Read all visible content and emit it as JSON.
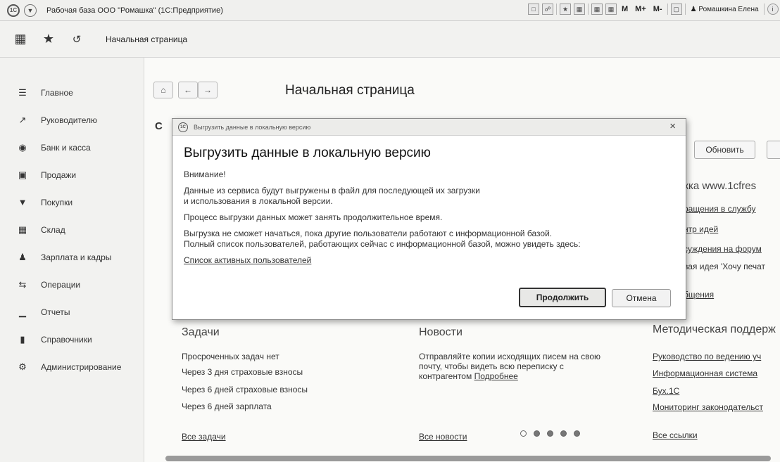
{
  "titlebar": {
    "logo": "1С",
    "title": "Рабочая база ООО \"Ромашка\" (1С:Предприятие)",
    "tools": [
      "M",
      "M+",
      "M-"
    ],
    "user": "Ромашкина Елена"
  },
  "sectionbar": {
    "tab": "Начальная страница"
  },
  "sidebar": {
    "items": [
      {
        "label": "Главное",
        "icon": "menu-icon"
      },
      {
        "label": "Руководителю",
        "icon": "chart-icon"
      },
      {
        "label": "Банк и касса",
        "icon": "coin-icon"
      },
      {
        "label": "Продажи",
        "icon": "bag-icon"
      },
      {
        "label": "Покупки",
        "icon": "cart-icon"
      },
      {
        "label": "Склад",
        "icon": "warehouse-icon"
      },
      {
        "label": "Зарплата и кадры",
        "icon": "person-icon"
      },
      {
        "label": "Операции",
        "icon": "operations-icon"
      },
      {
        "label": "Отчеты",
        "icon": "reports-icon"
      },
      {
        "label": "Справочники",
        "icon": "book-icon"
      },
      {
        "label": "Администрирование",
        "icon": "gear-icon"
      }
    ]
  },
  "main": {
    "title": "Начальная страница",
    "section_letter": "С",
    "refresh_label": "Обновить",
    "support": {
      "title": "жка www.1cfres",
      "links": [
        {
          "text": "ращения в службу"
        },
        {
          "text": "нтр идей"
        },
        {
          "text": "суждения на форум"
        },
        {
          "text": "вая идея 'Хочу печат",
          "plain": true
        },
        {
          "text": "бщения"
        }
      ]
    },
    "tasks": {
      "title": "Задачи",
      "rows": [
        "Просроченных задач нет",
        "Через 3 дня страховые взносы",
        "Через 6 дней страховые взносы",
        "Через 6 дней зарплата"
      ],
      "all_link": "Все задачи"
    },
    "news": {
      "title": "Новости",
      "text": "Отправляйте копии исходящих писем на свою почту, чтобы видеть всю переписку с контрагентом",
      "more_link": "Подробнее",
      "all_link": "Все новости"
    },
    "method": {
      "title": "Методическая поддерж",
      "links": [
        "Руководство по ведению уч",
        "Информационная система",
        "Бух.1С",
        "Мониторинг законодательст"
      ],
      "all_link": "Все ссылки"
    }
  },
  "modal": {
    "window_title": "Выгрузить данные в локальную версию",
    "heading": "Выгрузить данные в локальную версию",
    "attention": "Внимание!",
    "p1_line1": "Данные из сервиса будут выгружены в файл для последующей их загрузки",
    "p1_line2": "и использования в локальной версии.",
    "p2": "Процесс выгрузки данных может занять продолжительное время.",
    "p3_line1": "Выгрузка не сможет начаться, пока другие пользователи работают с информационной базой.",
    "p3_line2": "Полный список пользователей, работающих сейчас с информационной базой, можно увидеть здесь:",
    "users_link": "Список активных пользователей",
    "continue_label": "Продолжить",
    "cancel_label": "Отмена"
  }
}
